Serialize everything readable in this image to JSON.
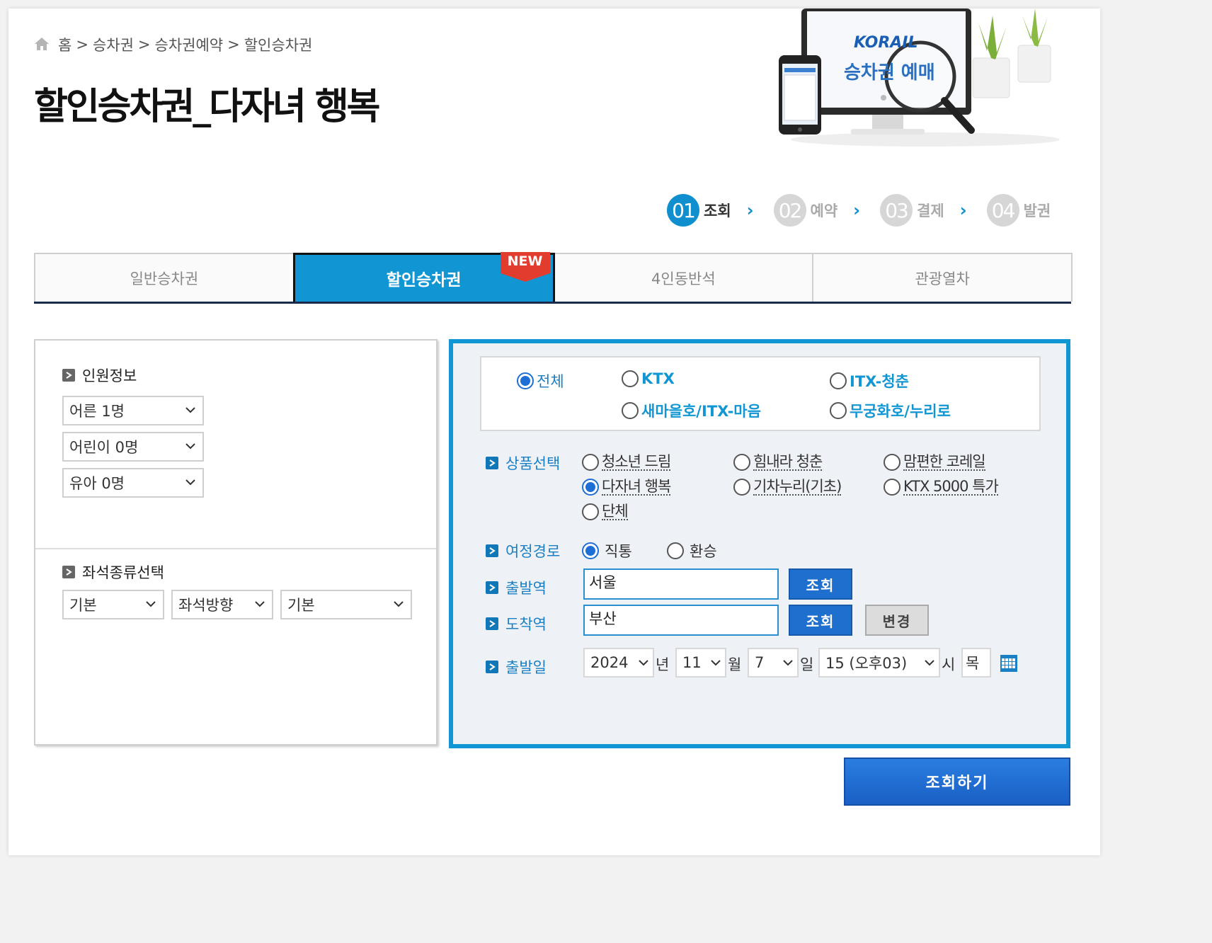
{
  "breadcrumb": {
    "home": "홈",
    "separator": ">",
    "items": [
      "승차권",
      "승차권예약",
      "할인승차권"
    ]
  },
  "page_title": "할인승차권_다자녀 행복",
  "hero": {
    "brand": "KORAIL",
    "caption": "승차권 예매"
  },
  "steps": [
    {
      "num": "01",
      "label": "조회",
      "active": true
    },
    {
      "num": "02",
      "label": "예약",
      "active": false
    },
    {
      "num": "03",
      "label": "결제",
      "active": false
    },
    {
      "num": "04",
      "label": "발권",
      "active": false
    }
  ],
  "tabs": [
    {
      "label": "일반승차권",
      "active": false
    },
    {
      "label": "할인승차권",
      "active": true,
      "badge": "NEW"
    },
    {
      "label": "4인동반석",
      "active": false
    },
    {
      "label": "관광열차",
      "active": false
    }
  ],
  "passenger_info": {
    "title": "인원정보",
    "selects": [
      "어른 1명",
      "어린이 0명",
      "유아 0명"
    ]
  },
  "seat_type": {
    "title": "좌석종류선택",
    "selects": [
      "기본",
      "좌석방향",
      "기본"
    ]
  },
  "train_types": [
    {
      "label": "전체",
      "selected": true
    },
    {
      "label": "KTX",
      "selected": false
    },
    {
      "label": "ITX-청춘",
      "selected": false
    },
    {
      "label": "새마을호/ITX-마음",
      "selected": false
    },
    {
      "label": "무궁화호/누리로",
      "selected": false
    }
  ],
  "product": {
    "label": "상품선택",
    "options": [
      {
        "label": "청소년 드림",
        "selected": false
      },
      {
        "label": "힘내라 청춘",
        "selected": false
      },
      {
        "label": "맘편한 코레일",
        "selected": false
      },
      {
        "label": "다자녀 행복",
        "selected": true
      },
      {
        "label": "기차누리(기초)",
        "selected": false
      },
      {
        "label": "KTX 5000 특가",
        "selected": false
      },
      {
        "label": "단체",
        "selected": false
      }
    ]
  },
  "route": {
    "label": "여정경로",
    "options": [
      {
        "label": "직통",
        "selected": true
      },
      {
        "label": "환승",
        "selected": false
      }
    ]
  },
  "departure_station": {
    "label": "출발역",
    "value": "서울",
    "button": "조회"
  },
  "arrival_station": {
    "label": "도착역",
    "value": "부산",
    "button": "조회",
    "change_button": "변경"
  },
  "departure_date": {
    "label": "출발일",
    "year": "2024",
    "year_unit": "년",
    "month": "11",
    "month_unit": "월",
    "day": "7",
    "day_unit": "일",
    "hour": "15 (오후03)",
    "hour_unit": "시",
    "weekday": "목"
  },
  "search_button": "조회하기",
  "colors": {
    "accent": "#1196d3",
    "button_blue": "#1f6fcf",
    "label_blue": "#1a7fc4"
  }
}
